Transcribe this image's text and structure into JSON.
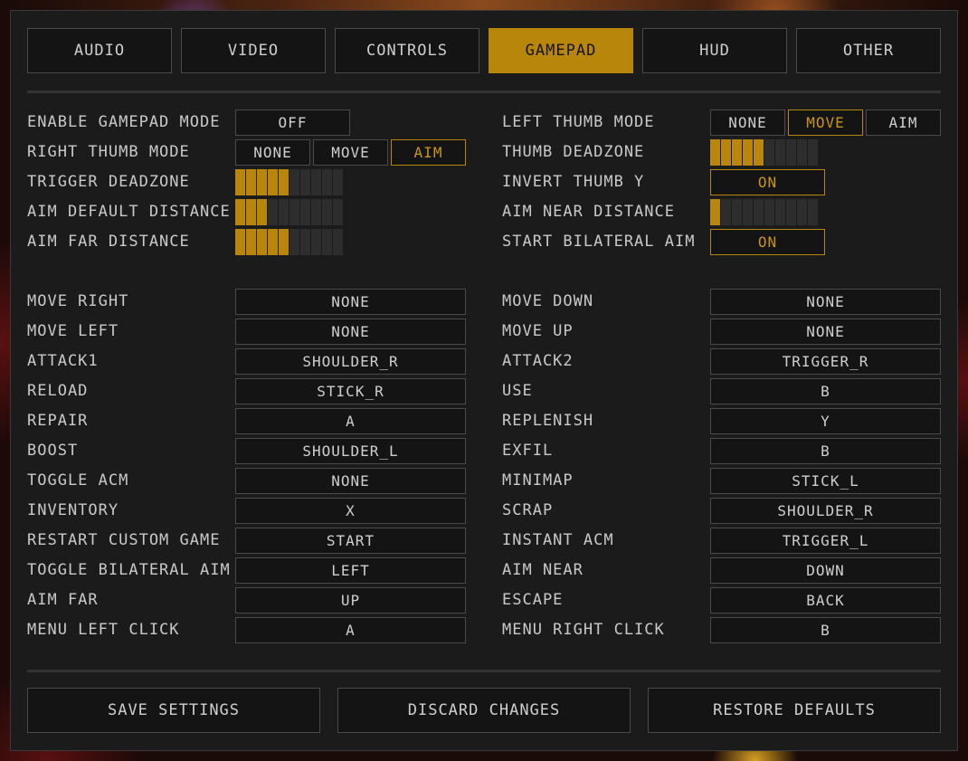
{
  "tabs": [
    "AUDIO",
    "VIDEO",
    "CONTROLS",
    "GAMEPAD",
    "HUD",
    "OTHER"
  ],
  "active_tab": "GAMEPAD",
  "settings_left": {
    "enable_gamepad_mode": {
      "label": "ENABLE GAMEPAD MODE",
      "value": "OFF"
    },
    "right_thumb_mode": {
      "label": "RIGHT THUMB MODE",
      "options": [
        "NONE",
        "MOVE",
        "AIM"
      ],
      "selected": "AIM"
    },
    "trigger_deadzone": {
      "label": "TRIGGER DEADZONE",
      "level": 5,
      "max": 10
    },
    "aim_default_distance": {
      "label": "AIM DEFAULT DISTANCE",
      "level": 3,
      "max": 10
    },
    "aim_far_distance": {
      "label": "AIM FAR DISTANCE",
      "level": 5,
      "max": 10
    }
  },
  "settings_right": {
    "left_thumb_mode": {
      "label": "LEFT THUMB MODE",
      "options": [
        "NONE",
        "MOVE",
        "AIM"
      ],
      "selected": "MOVE"
    },
    "thumb_deadzone": {
      "label": "THUMB DEADZONE",
      "level": 5,
      "max": 10
    },
    "invert_thumb_y": {
      "label": "INVERT THUMB Y",
      "value": "ON"
    },
    "aim_near_distance": {
      "label": "AIM NEAR DISTANCE",
      "level": 1,
      "max": 10
    },
    "start_bilateral_aim": {
      "label": "START BILATERAL AIM",
      "value": "ON"
    }
  },
  "bindings_left": [
    {
      "label": "MOVE RIGHT",
      "value": "NONE"
    },
    {
      "label": "MOVE LEFT",
      "value": "NONE"
    },
    {
      "label": "ATTACK1",
      "value": "SHOULDER_R"
    },
    {
      "label": "RELOAD",
      "value": "STICK_R"
    },
    {
      "label": "REPAIR",
      "value": "A"
    },
    {
      "label": "BOOST",
      "value": "SHOULDER_L"
    },
    {
      "label": "TOGGLE ACM",
      "value": "NONE"
    },
    {
      "label": "INVENTORY",
      "value": "X"
    },
    {
      "label": "RESTART CUSTOM GAME",
      "value": "START"
    },
    {
      "label": "TOGGLE BILATERAL AIM",
      "value": "LEFT"
    },
    {
      "label": "AIM FAR",
      "value": "UP"
    },
    {
      "label": "MENU LEFT CLICK",
      "value": "A"
    }
  ],
  "bindings_right": [
    {
      "label": "MOVE DOWN",
      "value": "NONE"
    },
    {
      "label": "MOVE UP",
      "value": "NONE"
    },
    {
      "label": "ATTACK2",
      "value": "TRIGGER_R"
    },
    {
      "label": "USE",
      "value": "B"
    },
    {
      "label": "REPLENISH",
      "value": "Y"
    },
    {
      "label": "EXFIL",
      "value": "B"
    },
    {
      "label": "MINIMAP",
      "value": "STICK_L"
    },
    {
      "label": "SCRAP",
      "value": "SHOULDER_R"
    },
    {
      "label": "INSTANT ACM",
      "value": "TRIGGER_L"
    },
    {
      "label": "AIM NEAR",
      "value": "DOWN"
    },
    {
      "label": "ESCAPE",
      "value": "BACK"
    },
    {
      "label": "MENU RIGHT CLICK",
      "value": "B"
    }
  ],
  "footer": {
    "save": "SAVE SETTINGS",
    "discard": "DISCARD CHANGES",
    "restore": "RESTORE DEFAULTS"
  },
  "colors": {
    "accent": "#b8860b",
    "panel": "#1b1b1b",
    "text": "#cfcfcf"
  }
}
